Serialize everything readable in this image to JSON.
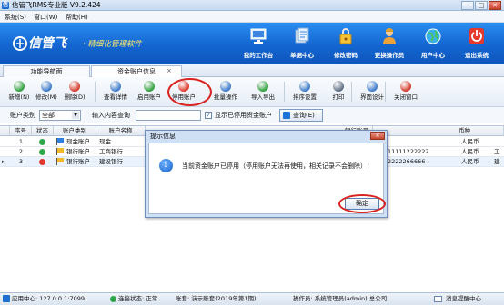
{
  "window": {
    "title": "信管飞RMS专业版 V9.2.424",
    "controls": {
      "minimize": "─",
      "maximize": "□",
      "close": "✕"
    }
  },
  "menu": [
    {
      "label": "系统(S)"
    },
    {
      "label": "窗口(W)"
    },
    {
      "label": "帮助(H)"
    }
  ],
  "banner": {
    "brand": "信管飞",
    "slogan": "· 精细化管理软件",
    "nav": [
      {
        "label": "我的工作台",
        "icon": "monitor-icon"
      },
      {
        "label": "单据中心",
        "icon": "documents-icon"
      },
      {
        "label": "修改密码",
        "icon": "key-lock-icon"
      },
      {
        "label": "更换操作员",
        "icon": "user-icon"
      },
      {
        "label": "用户中心",
        "icon": "globe-icon"
      },
      {
        "label": "退出系统",
        "icon": "power-icon"
      }
    ]
  },
  "tabs": [
    {
      "label": "功能导航面"
    },
    {
      "label": "资金账户信息",
      "close": "×"
    }
  ],
  "toolbar": [
    {
      "label": "新增(N)",
      "icon": "add-icon",
      "color": "#2e9e3a"
    },
    {
      "label": "修改(M)",
      "icon": "edit-icon",
      "color": "#3b79c8"
    },
    {
      "label": "删除(D)",
      "icon": "delete-icon",
      "color": "#d23a2a"
    },
    {
      "label": "查看详情",
      "icon": "view-icon",
      "color": "#3b79c8"
    },
    {
      "label": "启用账户",
      "icon": "enable-icon",
      "color": "#2e9e3a"
    },
    {
      "label": "停用账户",
      "icon": "disable-icon",
      "color": "#e0362a"
    },
    {
      "label": "批量操作",
      "icon": "batch-icon",
      "color": "#3b79c8"
    },
    {
      "label": "导入导出",
      "icon": "import-export-icon",
      "color": "#2e9e3a"
    },
    {
      "label": "排序设置",
      "icon": "sort-icon",
      "color": "#3b79c8"
    },
    {
      "label": "打印",
      "icon": "print-icon",
      "color": "#5b6b80"
    },
    {
      "label": "界面设计",
      "icon": "layout-icon",
      "color": "#3b79c8"
    },
    {
      "label": "关闭窗口",
      "icon": "close-window-icon",
      "color": "#d23a2a"
    }
  ],
  "filter": {
    "account_type_label": "账户类别",
    "account_type_value": "全部",
    "query_label": "输入内容查询",
    "query_value": "",
    "show_disabled_label": "显示已停用资金账户",
    "show_disabled_checked": true,
    "query_button": "查询(E)"
  },
  "grid": {
    "columns": [
      "序号",
      "状态",
      "账户类别",
      "账户名称",
      "银行账号",
      "币种"
    ],
    "rows": [
      {
        "no": "1",
        "status": "green",
        "type": "现金账户",
        "name": "现金",
        "bank_account": "",
        "currency": "人民币",
        "flag": "blue"
      },
      {
        "no": "2",
        "status": "green",
        "type": "银行账户",
        "name": "工商银行",
        "bank_account": "11111222222",
        "currency": "人民币",
        "flag": "yellow",
        "overflow": "工"
      },
      {
        "no": "3",
        "status": "red",
        "type": "银行账户",
        "name": "建设银行",
        "bank_account": "2222266666",
        "currency": "人民币",
        "flag": "yellow",
        "overflow": "建",
        "current": "▸"
      }
    ]
  },
  "dialog": {
    "title": "提示信息",
    "close": "✕",
    "icon": "info-icon",
    "icon_glyph": "i",
    "message": "当前资金账户已停用（停用账户无法再使用，相关记录不会删除）！",
    "ok": "确定"
  },
  "statusbar": {
    "app_center": "应用中心: 127.0.0.1:7099",
    "connection": "连接状态: 正常",
    "ledger": "账套: 演示账套(2019年第1期)",
    "operator": "操作员: 系统管理员(admin) 总公司",
    "messages": "消息提醒中心"
  }
}
